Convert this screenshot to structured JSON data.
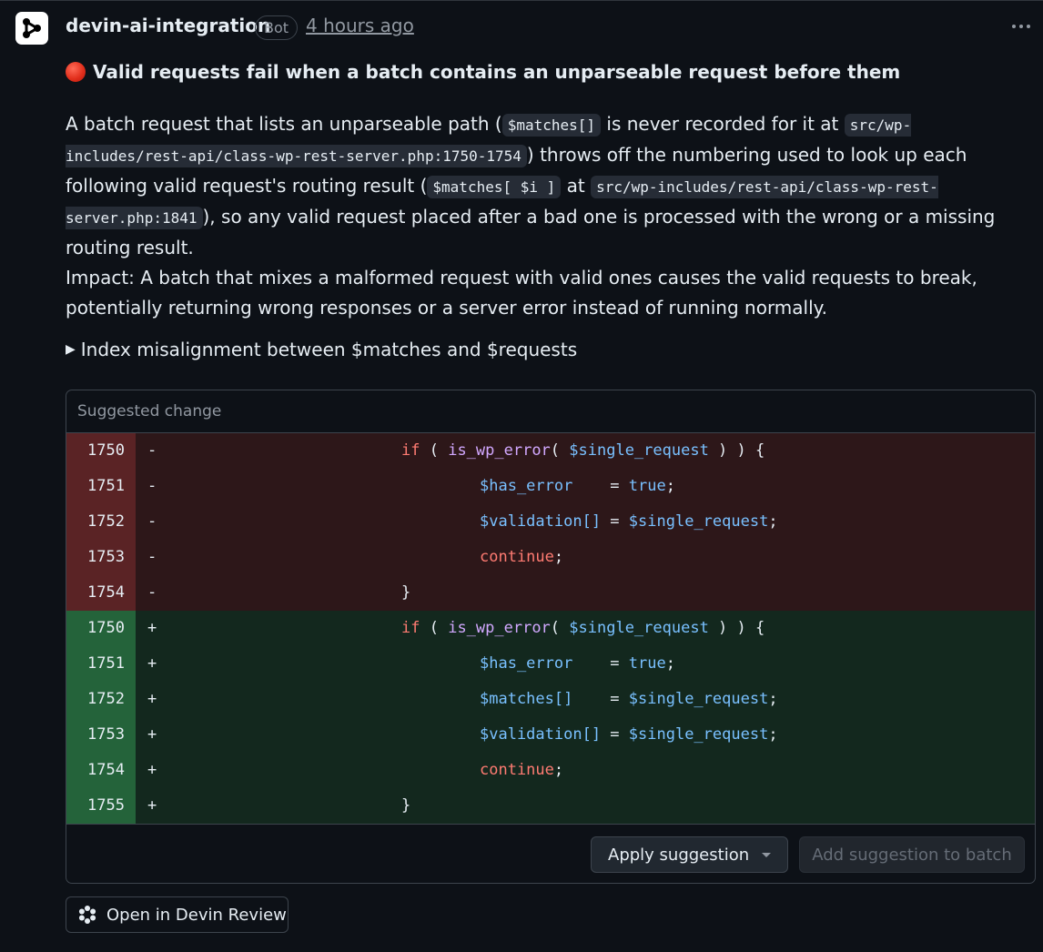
{
  "comment": {
    "author": "devin-ai-integration",
    "badge": "Bot",
    "timestamp": "4 hours ago",
    "title": "Valid requests fail when a batch contains an unparseable request before them",
    "body": {
      "p1_a": "A batch request that lists an unparseable path (",
      "p1_code1": "$matches[]",
      "p1_b": " is never recorded for it at ",
      "p1_code2": "src/wp-includes/rest-api/class-wp-rest-server.php:1750-1754",
      "p1_c": ") throws off the numbering used to look up each following valid request's routing result (",
      "p1_code3": "$matches[ $i ]",
      "p1_d": " at ",
      "p1_code4": "src/wp-includes/rest-api/class-wp-rest-server.php:1841",
      "p1_e": "), so any valid request placed after a bad one is processed with the wrong or a missing routing result.",
      "p2": "Impact: A batch that mixes a malformed request with valid ones causes the valid requests to break, potentially returning wrong responses or a server error instead of running normally."
    },
    "details_summary": "Index misalignment between $matches and $requests"
  },
  "suggestion": {
    "header": "Suggested change",
    "removed": [
      {
        "ln": "1750",
        "mark": "-"
      },
      {
        "ln": "1751",
        "mark": "-"
      },
      {
        "ln": "1752",
        "mark": "-"
      },
      {
        "ln": "1753",
        "mark": "-"
      },
      {
        "ln": "1754",
        "mark": "-"
      }
    ],
    "added": [
      {
        "ln": "1750",
        "mark": "+"
      },
      {
        "ln": "1751",
        "mark": "+"
      },
      {
        "ln": "1752",
        "mark": "+"
      },
      {
        "ln": "1753",
        "mark": "+"
      },
      {
        "ln": "1754",
        "mark": "+"
      },
      {
        "ln": "1755",
        "mark": "+"
      }
    ],
    "tokens": {
      "if": "if",
      "paren_open": " ( ",
      "is_wp_error": "is_wp_error",
      "call_open": "( ",
      "single_request": "$single_request",
      "paren_close": " ) ) {",
      "has_error": "$has_error",
      "assign_pad": "    = ",
      "true": "true",
      "semi": ";",
      "validation": "$validation[]",
      "assign": " = ",
      "matches": "$matches[]",
      "continue": "continue",
      "close_brace": "}"
    },
    "apply_label": "Apply suggestion",
    "batch_label": "Add suggestion to batch"
  },
  "devin_button": "Open in Devin Review",
  "colors": {
    "background": "#0d1117",
    "removed_bg": "#2d1719",
    "added_bg": "#13281e",
    "keyword": "#ff7b72",
    "function": "#d2a8ff",
    "variable": "#79c0ff"
  },
  "icons": {
    "avatar": "devin-logo-icon",
    "status": "red-circle-icon",
    "menu": "kebab-menu-icon",
    "dropdown": "caret-down-icon",
    "devin": "devin-flower-icon"
  }
}
